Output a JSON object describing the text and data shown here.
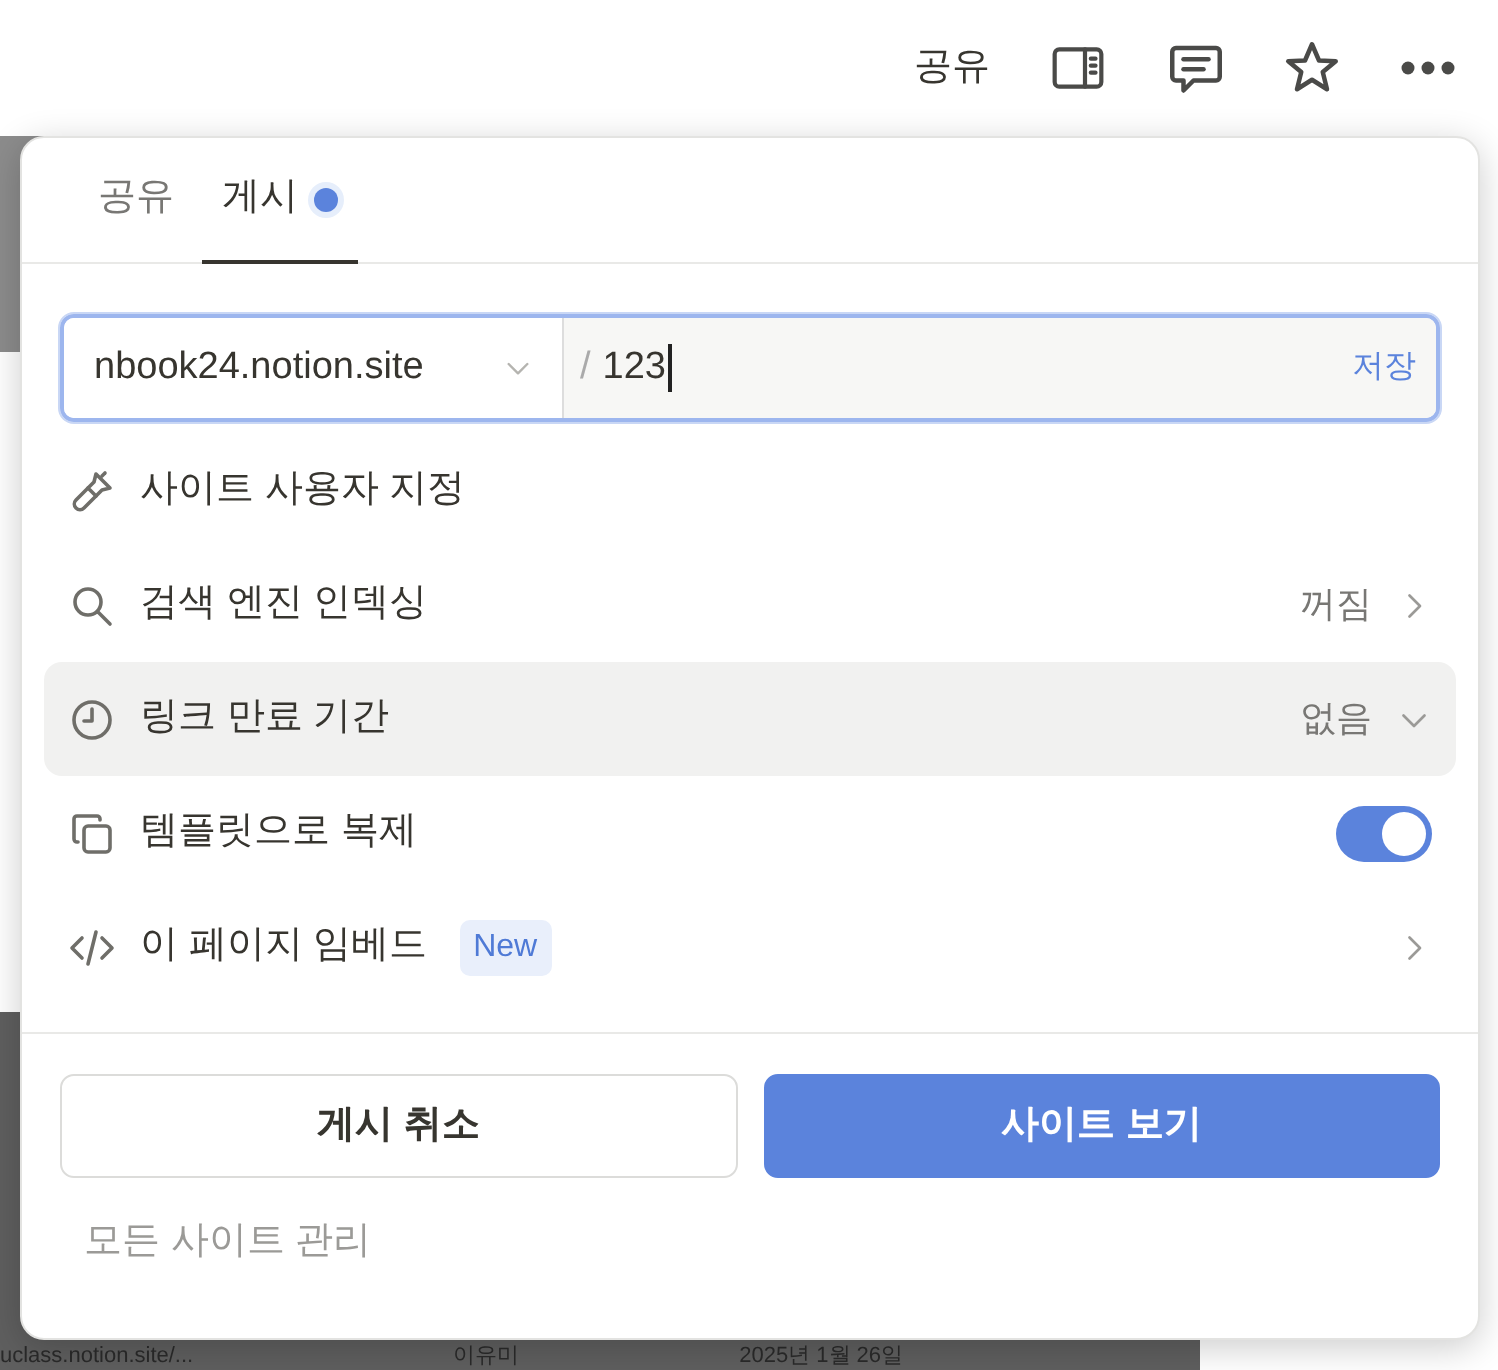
{
  "top_bar": {
    "share_label": "공유"
  },
  "background_row": [
    "uclass.notion.site/...",
    "이유미",
    "2025년 1월 26일"
  ],
  "popup": {
    "tabs": [
      {
        "label": "공유",
        "selected": false,
        "dot": false
      },
      {
        "label": "게시",
        "selected": true,
        "dot": true
      }
    ],
    "url": {
      "domain": "nbook24.notion.site",
      "separator": "/",
      "value": "123",
      "save": "저장"
    },
    "options": [
      {
        "kind": "action",
        "label": "사이트 사용자 지정",
        "hovered": false
      },
      {
        "kind": "nav",
        "label": "검색 엔진 인덱싱",
        "value": "꺼짐",
        "hovered": false
      },
      {
        "kind": "dropdown",
        "label": "링크 만료 기간",
        "value": "없음",
        "hovered": true
      },
      {
        "kind": "toggle",
        "label": "템플릿으로 복제",
        "on": true,
        "hovered": false
      },
      {
        "kind": "nav",
        "label": "이 페이지 임베드",
        "badge": "New",
        "hovered": false
      }
    ],
    "buttons": [
      {
        "kind": "secondary",
        "label": "게시 취소"
      },
      {
        "kind": "primary",
        "label": "사이트 보기"
      }
    ],
    "footer_link": "모든 사이트 관리"
  }
}
